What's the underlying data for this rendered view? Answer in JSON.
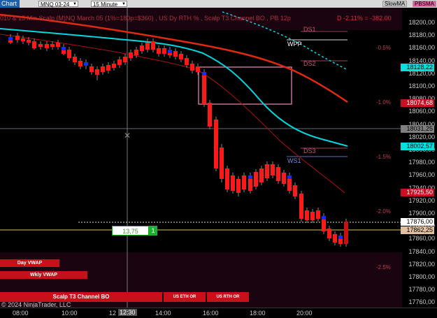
{
  "toolbar": {
    "chart_tab": "Chart",
    "instrument": "MNQ 03-24",
    "interval": "15 Minute",
    "buttons": [
      "SlowMA",
      "PBSMA"
    ]
  },
  "chart": {
    "title": "010 & 15 Min Scalp (M)NQ March 05 (1%=180p=$360) , US Dy RTH % , Scalp T3 Channel BO , PB 12p",
    "title_right": "D -2.11% = -382.00",
    "level_labels": {
      "ds1": "DS1",
      "wpp": "WPP",
      "ds2": "DS2",
      "ds3": "DS3",
      "ws1": "WS1"
    },
    "pct_labels": [
      "-0.5%",
      "-1.0%",
      "-1.5%",
      "-2.0%",
      "-2.5%"
    ],
    "y_ticks": [
      "18200,00",
      "18180,00",
      "18160,00",
      "18140,00",
      "18120,00",
      "18100,00",
      "18080,00",
      "18060,00",
      "18040,00",
      "18020,00",
      "18000,00",
      "17980,00",
      "17960,00",
      "17940,00",
      "17920,00",
      "17900,00",
      "17880,00",
      "17860,00",
      "17840,00",
      "17820,00",
      "17800,00",
      "17780,00",
      "17760,00"
    ],
    "y_tags": [
      {
        "text": "18128,22",
        "bg": "#00e0e0",
        "fg": "#000"
      },
      {
        "text": "18074,68",
        "bg": "#c81020",
        "fg": "#fff"
      },
      {
        "text": "18031,25",
        "bg": "#808080",
        "fg": "#000"
      },
      {
        "text": "18002,57",
        "bg": "#00e0e0",
        "fg": "#000"
      },
      {
        "text": "17925,50",
        "bg": "#c81020",
        "fg": "#fff"
      },
      {
        "text": "17876,00",
        "bg": "#ffffff",
        "fg": "#000"
      },
      {
        "text": "17862,25",
        "bg": "#e0c0a0",
        "fg": "#000"
      }
    ],
    "x_ticks": [
      "08:00",
      "10:00",
      "12",
      "14:00",
      "16:00",
      "18:00",
      "20:00"
    ],
    "x_cursor": "12:30",
    "order_qty": "13,75",
    "order_count": "1",
    "buttons": {
      "day_vwap": "Day VWAP",
      "wkly_vwap": "Wkly VWAP",
      "scalp_t3": "Scalp T3 Channel BO",
      "us_eth_or": "US ETH OR",
      "us_rth_or": "US RTH OR"
    },
    "copyright": "© 2024 NinjaTrader, LLC",
    "colors": {
      "up": "#ff1a1a",
      "down": "#c81010",
      "signal": "#1a2bff",
      "fast_ma": "#00d8e0",
      "slow_ma": "#e02a10",
      "box": "#e080b0"
    }
  }
}
